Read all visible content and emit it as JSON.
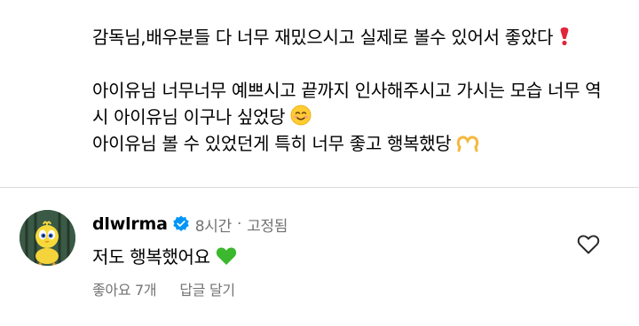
{
  "parent_comment": {
    "lines": [
      "감독님,배우분들 다 너무 재밌으시고 실제로 볼수 있어서 좋았다",
      "아이유님 너무너무 예쁘시고 끝까지 인사해주시고 가시는 모습 너무 역시 아이유님 이구나 싶었당",
      "아이유님 볼 수 있었던게 특히  너무 좋고 행복했당"
    ],
    "emojis": [
      "heavy-exclamation-icon",
      "smiling-face-icon",
      "heart-hands-icon"
    ]
  },
  "reply": {
    "username": "dlwlrma",
    "time": "8시간",
    "separator": "·",
    "pinned_label": "고정됨",
    "text": "저도 행복했어요",
    "emoji": "green-heart-icon",
    "likes_label": "좋아요 7개",
    "reply_label": "답글 달기"
  },
  "colors": {
    "verified_badge": "#0095f6",
    "meta_text": "#737373",
    "green_heart": "#3bb82e",
    "exclamation": "#e0263a"
  }
}
